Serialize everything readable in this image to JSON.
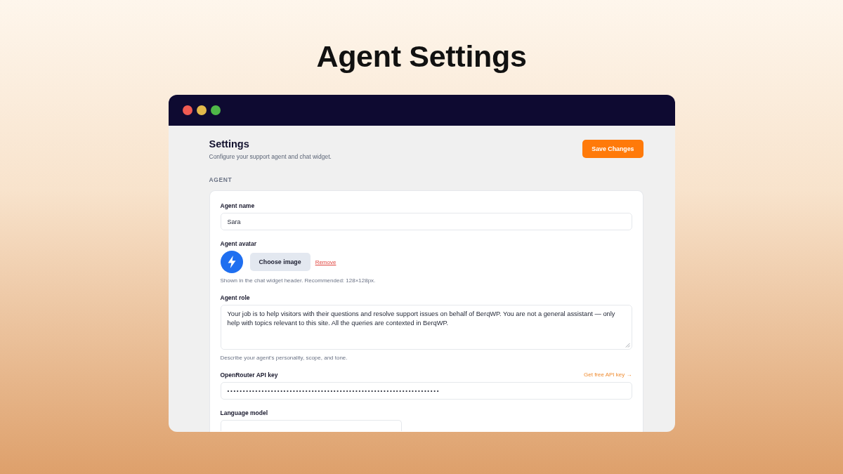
{
  "page_title": "Agent Settings",
  "window": {
    "traffic_lights": [
      {
        "color": "#f05b52"
      },
      {
        "color": "#e2b94b"
      },
      {
        "color": "#4fb748"
      }
    ]
  },
  "header": {
    "title": "Settings",
    "subtitle": "Configure your support agent and chat widget.",
    "save_button": "Save Changes"
  },
  "section": {
    "label": "AGENT"
  },
  "fields": [
    {
      "kind": "text",
      "label": "Agent name",
      "value": "Sara"
    },
    {
      "kind": "avatar",
      "label": "Agent avatar",
      "button": "Choose image",
      "remove_link": "Remove",
      "help": "Shown in the chat widget header. Recommended: 128×128px."
    },
    {
      "kind": "textarea",
      "label": "Agent role",
      "value": "Your job is to help visitors with their questions and resolve support issues on behalf of BerqWP. You are not a general assistant — only help with topics relevant to this site. All the queries are contexted in BerqWP.",
      "help": "Describe your agent's personality, scope, and tone."
    },
    {
      "kind": "password",
      "label": "OpenRouter API key",
      "link": "Get free API key →",
      "value": "••••••••••••••••••••••••••••••••••••••••••••••••••••••••••••••••••••"
    },
    {
      "kind": "select",
      "label": "Language model"
    }
  ]
}
